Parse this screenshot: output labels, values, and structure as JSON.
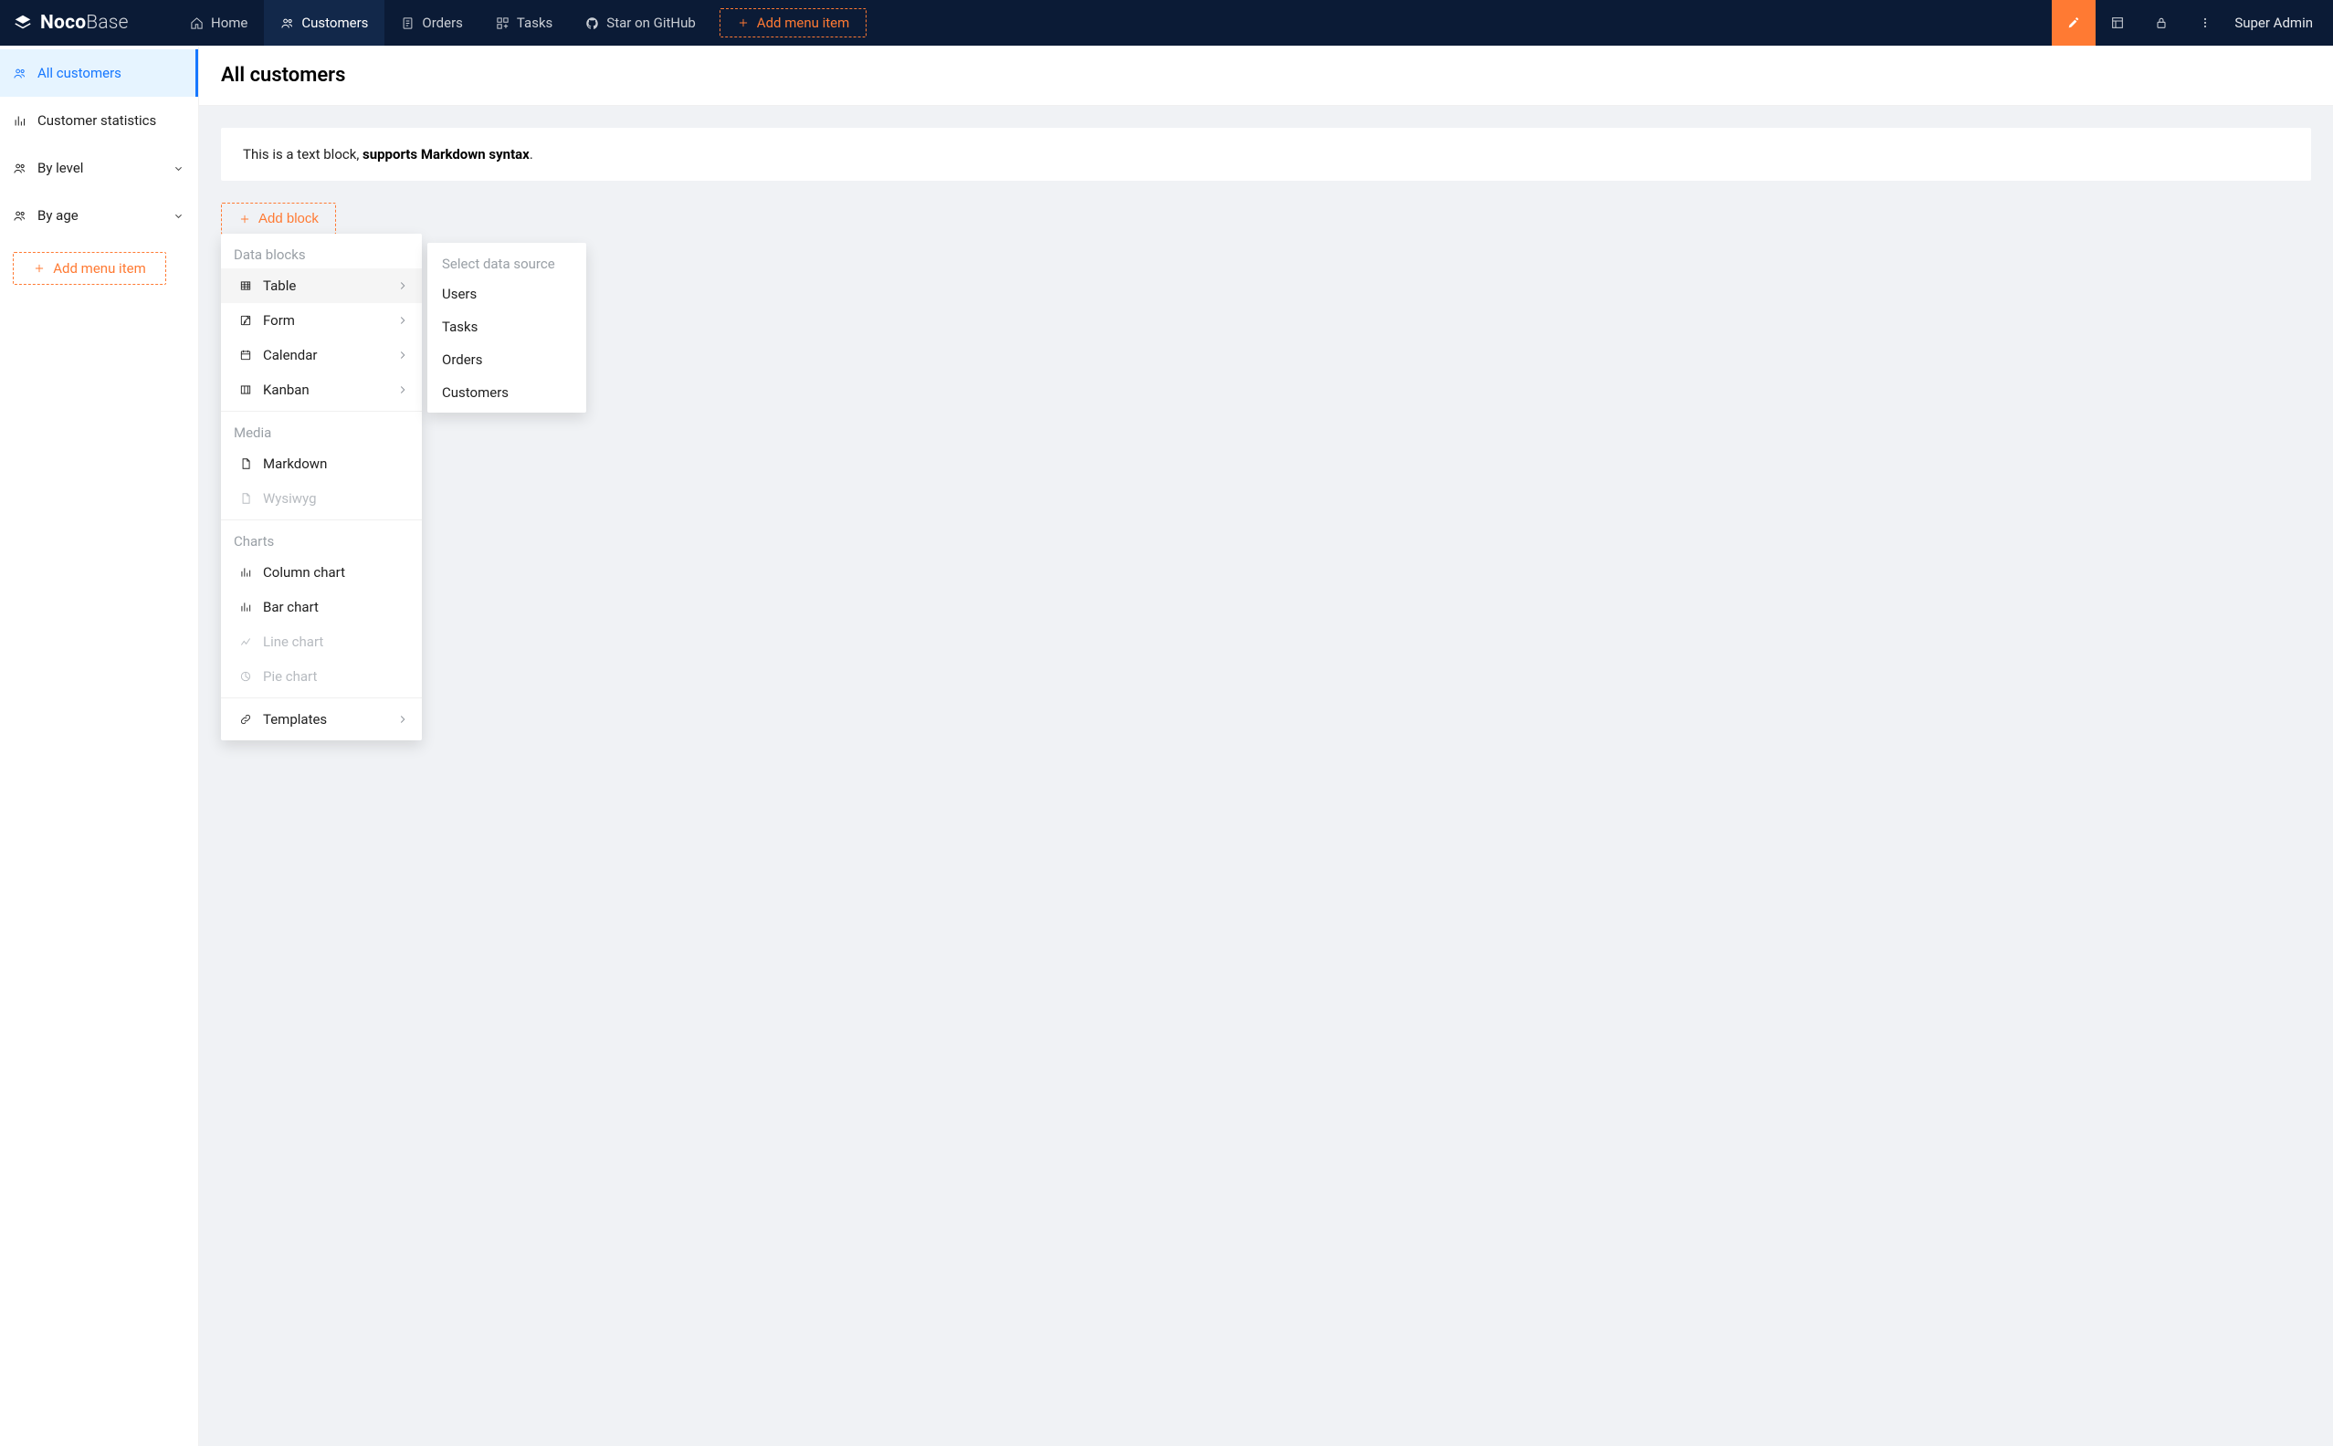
{
  "brand": {
    "part1": "Noco",
    "part2": "Base"
  },
  "topnav": {
    "items": [
      {
        "label": "Home"
      },
      {
        "label": "Customers"
      },
      {
        "label": "Orders"
      },
      {
        "label": "Tasks"
      },
      {
        "label": "Star on GitHub"
      }
    ],
    "add_label": "Add menu item",
    "user": "Super Admin"
  },
  "sidebar": {
    "items": [
      {
        "label": "All customers"
      },
      {
        "label": "Customer statistics"
      },
      {
        "label": "By level"
      },
      {
        "label": "By age"
      }
    ],
    "add_label": "Add menu item"
  },
  "page": {
    "title": "All customers",
    "markdown_prefix": "This is a text block, ",
    "markdown_bold": "supports Markdown syntax",
    "markdown_suffix": "."
  },
  "add_block": {
    "label": "Add block"
  },
  "menu": {
    "sections": {
      "data_blocks": "Data blocks",
      "media": "Media",
      "charts": "Charts"
    },
    "items": {
      "table": "Table",
      "form": "Form",
      "calendar": "Calendar",
      "kanban": "Kanban",
      "markdown": "Markdown",
      "wysiwyg": "Wysiwyg",
      "column_chart": "Column chart",
      "bar_chart": "Bar chart",
      "line_chart": "Line chart",
      "pie_chart": "Pie chart",
      "templates": "Templates"
    }
  },
  "submenu": {
    "label": "Select data source",
    "items": [
      "Users",
      "Tasks",
      "Orders",
      "Customers"
    ]
  }
}
